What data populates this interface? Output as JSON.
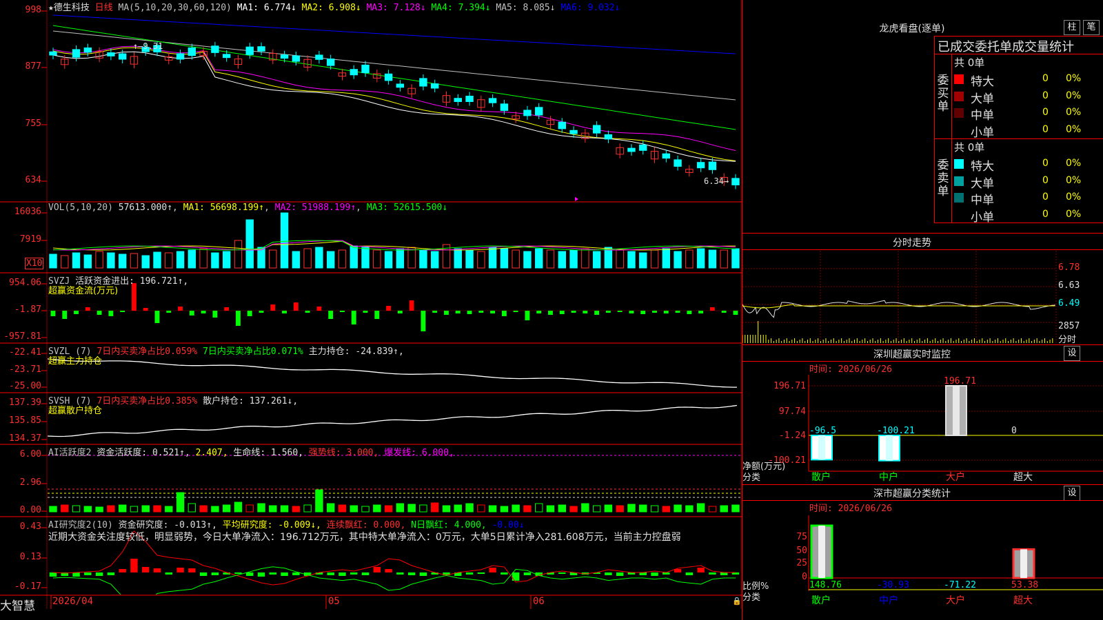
{
  "colors": {
    "up": "#ff3030",
    "down": "#00ffff",
    "vol_dn": "#00ffff",
    "bg": "#000000",
    "grid": "#800000",
    "ma1": "#ffffff",
    "ma2": "#ffff00",
    "ma3": "#ff00ff",
    "ma4": "#00ff00",
    "ma5": "#c0c0c0",
    "ma6": "#0000ff",
    "green_bar": "#00ff00",
    "red_bar": "#ff0000",
    "purple_line": "#ff00ff"
  },
  "main": {
    "title_star": "★",
    "stock_name": "德生科技",
    "period": "日线",
    "ma_label": "MA(5,10,20,30,60,120)",
    "ma1": "MA1: 6.774↓",
    "ma2": "MA2: 6.908↓",
    "ma3": "MA3: 7.128↓",
    "ma4": "MA4: 7.394↓",
    "ma5": "MA5: 8.085↓",
    "ma6": "MA6: 9.032↓",
    "y_ticks": [
      "998",
      "877",
      "755",
      "634"
    ],
    "high_mark": "9.31",
    "low_mark": "6.34"
  },
  "vol": {
    "label": "VOL(5,10,20)",
    "value": "57613.000↑",
    "ma1": "MA1: 56698.199↑",
    "ma2": "MA2: 51988.199↑",
    "ma3": "MA3: 52615.500↓",
    "y_ticks": [
      "16036",
      "7919"
    ],
    "unit": "X10"
  },
  "svzj": {
    "label": "SVZJ",
    "desc": "活跃资金进出: 196.721↑,",
    "sub": "超赢资金流(万元)",
    "y_ticks": [
      "954.06",
      "-1.87",
      "-957.81"
    ]
  },
  "svzl": {
    "label": "SVZL (7)",
    "p1": "7日内买卖净占比0.059%",
    "p2": "7日内买卖净占比0.071%",
    "p3": "主力持仓: -24.839↑,",
    "sub": "超赢主力持仓",
    "y_ticks": [
      "-22.41",
      "-23.71",
      "-25.00"
    ]
  },
  "svsh": {
    "label": "SVSH (7)",
    "p1": "7日内买卖净占比0.385%",
    "p2": "散户持仓: 137.261↓,",
    "sub": "超赢散户持仓",
    "y_ticks": [
      "137.39",
      "135.85",
      "134.37"
    ]
  },
  "ai_active": {
    "label": "AI活跃度2",
    "p1": "资金活跃度: 0.521↑,",
    "p2": "2.407,",
    "p3": "生命线: 1.560,",
    "p4": "强势线: 3.000,",
    "p5": "爆发线: 6.000,",
    "y_ticks": [
      "6.00",
      "2.96",
      "0.00"
    ]
  },
  "ai_research": {
    "label": "AI研究度2(10)",
    "p1": "资金研究度: -0.013↑,",
    "p2": "平均研究度: -0.009↓,",
    "p3": "连续飘红: 0.000,",
    "p4": "N日飘红: 4.000,",
    "p5": "-0.00↓",
    "comment": "近期大资金关注度较低，明显弱势，今日大单净流入：196.712万元，其中特大单净流入：0万元，大单5日累计净入281.608万元，当前主力控盘弱",
    "y_ticks": [
      "0.43",
      "0.13",
      "-0.17"
    ]
  },
  "bottom": {
    "brand": "大智慧",
    "date1": "2026/04",
    "date2": "05",
    "date3": "06"
  },
  "longhu": {
    "title": "龙虎看盘(逐单)",
    "btn1": "柱",
    "btn2": "笔",
    "header": "已成交委托单成交量统计",
    "buy_label": "委买单",
    "sell_label": "委卖单",
    "buy_total": "共 0单",
    "sell_total": "共 0单",
    "buy_rows": [
      {
        "name": "特大",
        "count": "0",
        "pct": "0%",
        "color": "#ff0000"
      },
      {
        "name": "大单",
        "count": "0",
        "pct": "0%",
        "color": "#a00000"
      },
      {
        "name": "中单",
        "count": "0",
        "pct": "0%",
        "color": "#600000"
      },
      {
        "name": "小单",
        "count": "0",
        "pct": "0%",
        "color": ""
      }
    ],
    "sell_rows": [
      {
        "name": "特大",
        "count": "0",
        "pct": "0%",
        "color": "#00ffff"
      },
      {
        "name": "大单",
        "count": "0",
        "pct": "0%",
        "color": "#00a0a0"
      },
      {
        "name": "中单",
        "count": "0",
        "pct": "0%",
        "color": "#007070"
      },
      {
        "name": "小单",
        "count": "0",
        "pct": "0%",
        "color": ""
      }
    ]
  },
  "fenshi": {
    "title": "分时走势",
    "y_ticks": [
      "6.78",
      "6.63",
      "6.49"
    ],
    "vol_tick": "2857",
    "vol_unit": "分时"
  },
  "monitor": {
    "title": "深圳超赢实时监控",
    "btn": "设",
    "time": "时间: 2026/06/26",
    "y_ticks": [
      "196.71",
      "97.74",
      "-1.24",
      "-100.21"
    ],
    "y_unit": "净额(万元)",
    "x_unit": "分类",
    "values": [
      {
        "cat": "散户",
        "value": "-96.5",
        "color": "#00ffff"
      },
      {
        "cat": "中户",
        "value": "-100.21",
        "color": "#00ffff"
      },
      {
        "cat": "大户",
        "value": "196.71",
        "color": "#ff3030"
      },
      {
        "cat": "超大",
        "value": "0",
        "color": "#e0e0e0"
      }
    ]
  },
  "stats": {
    "title": "深市超赢分类统计",
    "btn": "设",
    "time": "时间: 2026/06/26",
    "y_ticks": [
      "75",
      "50",
      "25",
      "0"
    ],
    "y_unit": "比例%",
    "x_unit": "分类",
    "values": [
      {
        "cat": "散户",
        "value": "148.76",
        "color": "#00ff00"
      },
      {
        "cat": "中户",
        "value": "-30.93",
        "color": "#0000ff"
      },
      {
        "cat": "大户",
        "value": "-71.22",
        "color": "#00ffff"
      },
      {
        "cat": "超大",
        "value": "53.38",
        "color": "#ff3030"
      }
    ]
  }
}
